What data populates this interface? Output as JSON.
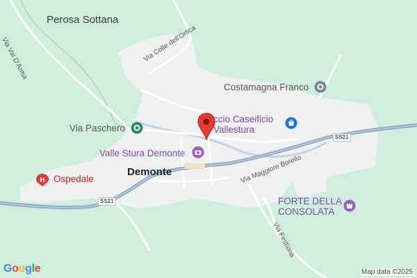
{
  "map": {
    "colors": {
      "land": "#cfeedd",
      "urban": "#eef0f2",
      "road_minor": "#ffffff",
      "highway": "#8fa7c1",
      "river": "#9ab4cc",
      "pin": "#e53935",
      "poi_purple": "#9c5bc9",
      "poi_red": "#e53935",
      "poi_green": "#2f8a63",
      "poi_gray": "#7a8590"
    },
    "places": {
      "perosa": "Perosa Sottana",
      "demonte": "Demonte",
      "paschero": "Via Paschero",
      "costamagna": "Costamagna Franco",
      "caseificio": "ccio Caseificio\nVallestura",
      "valle_stura": "Valle Stura Demonte",
      "ospedale": "Ospedale",
      "forte": "FORTE DELLA\nCONSOLATA"
    },
    "streets": {
      "val_darma": "Via Val D'Arma",
      "colle_ortica": "Via Colle dell'Ortica",
      "maggiore": "Via Maggiore Borello",
      "festiona": "Via Festiona"
    },
    "road_badges": {
      "ss21_left": "SS21",
      "ss21_right": "SS21"
    },
    "icons": {
      "pin": "location-pin-icon",
      "hospital": "hospital-icon",
      "shopping": "shopping-bag-icon",
      "camera": "camera-icon",
      "castle": "castle-icon",
      "landmark": "landmark-icon",
      "circle_poi": "place-circle-icon"
    },
    "google_logo": "Google",
    "attribution": "Map data ©2025"
  }
}
